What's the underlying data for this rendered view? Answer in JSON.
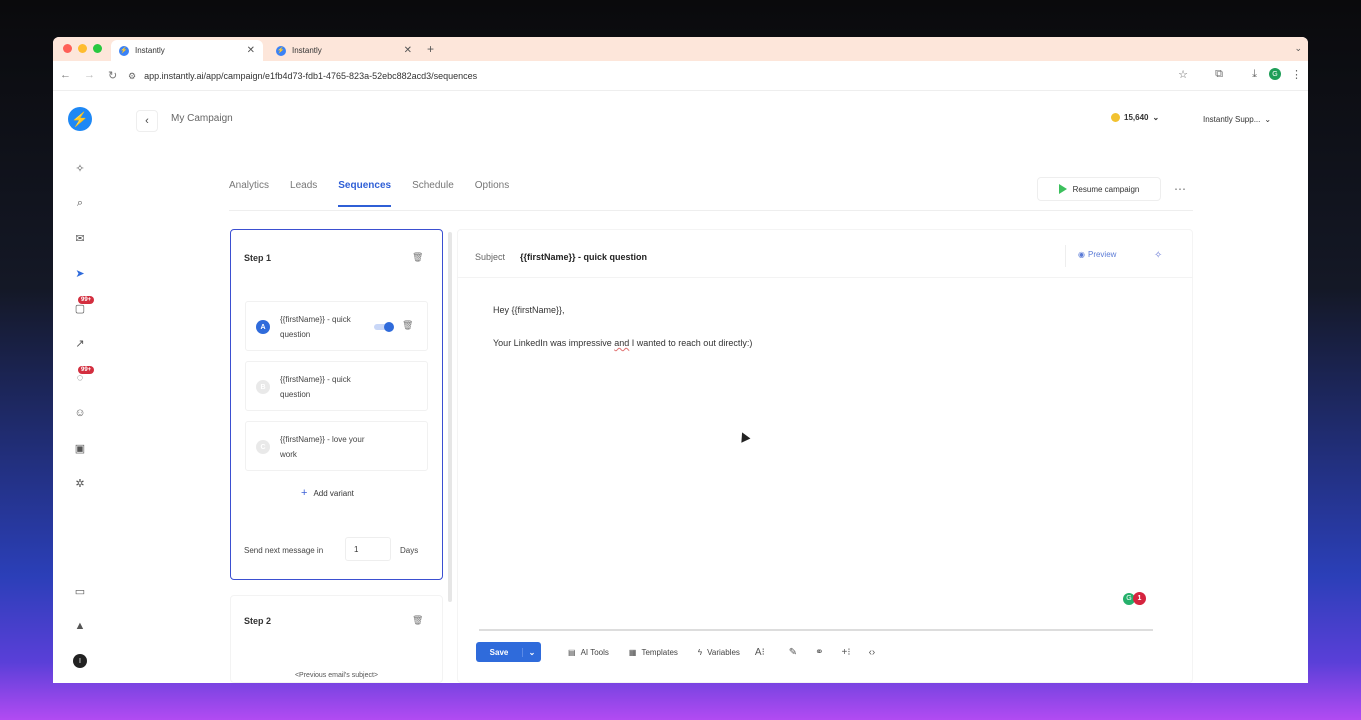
{
  "browser": {
    "tabs": [
      {
        "title": "Instantly",
        "active": true
      },
      {
        "title": "Instantly",
        "active": false
      }
    ],
    "url": "app.instantly.ai/app/campaign/e1fb4d73-fdb1-4765-823a-52ebc882acd3/sequences",
    "profile_initial": "G"
  },
  "sidebar": {
    "badges": [
      "99+",
      "99+"
    ]
  },
  "header": {
    "campaign_title": "My Campaign",
    "credits": "15,640",
    "workspace": "Instantly Supp..."
  },
  "nav": {
    "tabs": [
      "Analytics",
      "Leads",
      "Sequences",
      "Schedule",
      "Options"
    ],
    "active": "Sequences",
    "resume_label": "Resume campaign"
  },
  "steps": [
    {
      "title": "Step 1",
      "variants": [
        {
          "letter": "A",
          "subject": "{{firstName}} - quick question",
          "active": true
        },
        {
          "letter": "B",
          "subject": "{{firstName}} - quick question",
          "active": false
        },
        {
          "letter": "C",
          "subject": "{{firstName}} - love your work",
          "active": false
        }
      ],
      "add_variant_label": "Add variant",
      "send_next_label": "Send next message in",
      "send_next_value": "1",
      "days_label": "Days"
    },
    {
      "title": "Step 2",
      "preview_subject": "<Previous email's subject>"
    }
  ],
  "editor": {
    "subject_label": "Subject",
    "subject_value": "{{firstName}} - quick question",
    "preview_label": "Preview",
    "body_line1": "Hey {{firstName}},",
    "body_line2_a": "Your LinkedIn was impressive ",
    "body_line2_b": "and",
    "body_line2_c": " I wanted to reach out directly:)",
    "grammar_count": "1",
    "toolbar": {
      "save_label": "Save",
      "ai_tools": "AI Tools",
      "templates": "Templates",
      "variables": "Variables"
    }
  },
  "colors": {
    "accent": "#2f6bdb",
    "tab_bar": "#fde6da",
    "badge": "#d32f3f",
    "play": "#3cc05d"
  }
}
